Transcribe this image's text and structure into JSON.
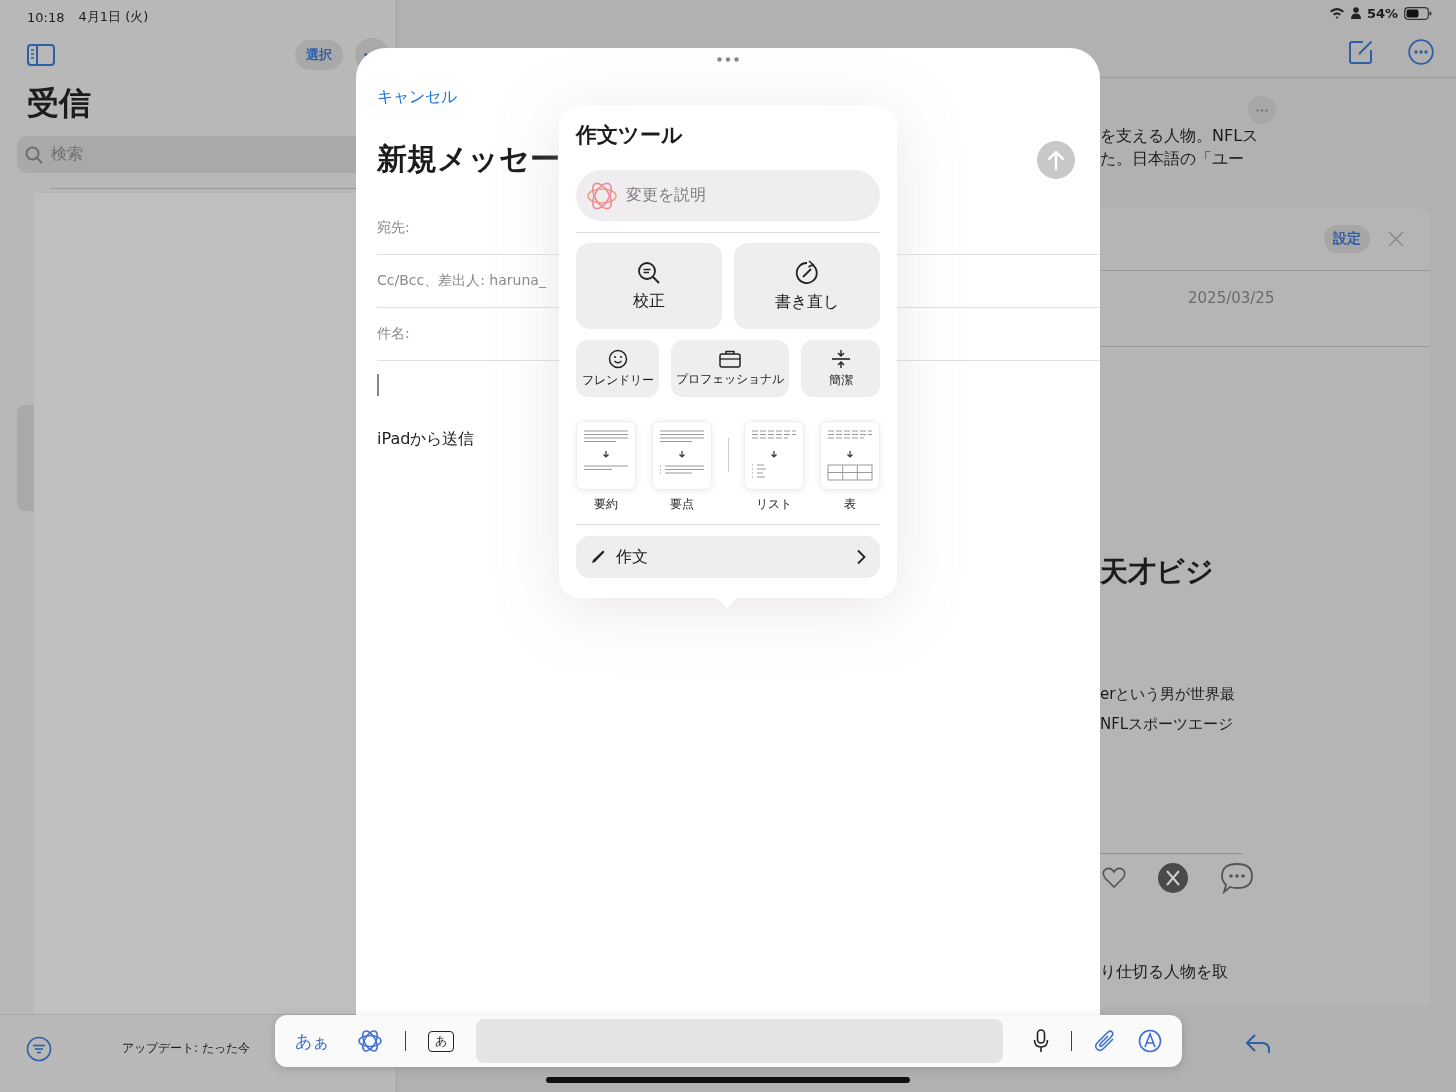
{
  "status_bar": {
    "time": "10:18",
    "date": "4月1日 (火)",
    "battery": "54%"
  },
  "mailbox": {
    "select_button": "選択",
    "title": "受信",
    "search": {
      "placeholder": "検索"
    },
    "update_status": "アップデート: たった今"
  },
  "message_view": {
    "lines_top": [
      "を支える人物。NFLス",
      "た。日本語の「ユー"
    ],
    "card": {
      "settings_button": "設定",
      "date": "2025/03/25",
      "heading": "天才ビジ",
      "body_lines": [
        "erという男が世界最",
        "NFLスポーツエージ"
      ],
      "footer_text": "り仕切る人物を取"
    }
  },
  "compose": {
    "cancel": "キャンセル",
    "title": "新規メッセー",
    "fields": [
      {
        "label": "宛先:"
      },
      {
        "label": "Cc/Bcc、差出人: haruna_"
      },
      {
        "label": "件名:"
      }
    ],
    "signature": "iPadから送信"
  },
  "writing_tools": {
    "title": "作文ツール",
    "describe": {
      "placeholder": "変更を説明"
    },
    "primary_actions": [
      {
        "kind": "proofread",
        "label": "校正"
      },
      {
        "kind": "rewrite",
        "label": "書き直し"
      }
    ],
    "tones": [
      {
        "kind": "friendly",
        "label": "フレンドリー"
      },
      {
        "kind": "professional",
        "label": "プロフェッショナル"
      },
      {
        "kind": "concise",
        "label": "簡潔"
      }
    ],
    "formats": [
      {
        "kind": "summary",
        "label": "要約"
      },
      {
        "kind": "key_points",
        "label": "要点"
      },
      {
        "kind": "list",
        "label": "リスト"
      },
      {
        "kind": "table",
        "label": "表"
      }
    ],
    "compose_row": {
      "label": "作文"
    }
  },
  "keyboard_bar": {
    "font_button": "あぁ",
    "key_label": "あ"
  }
}
